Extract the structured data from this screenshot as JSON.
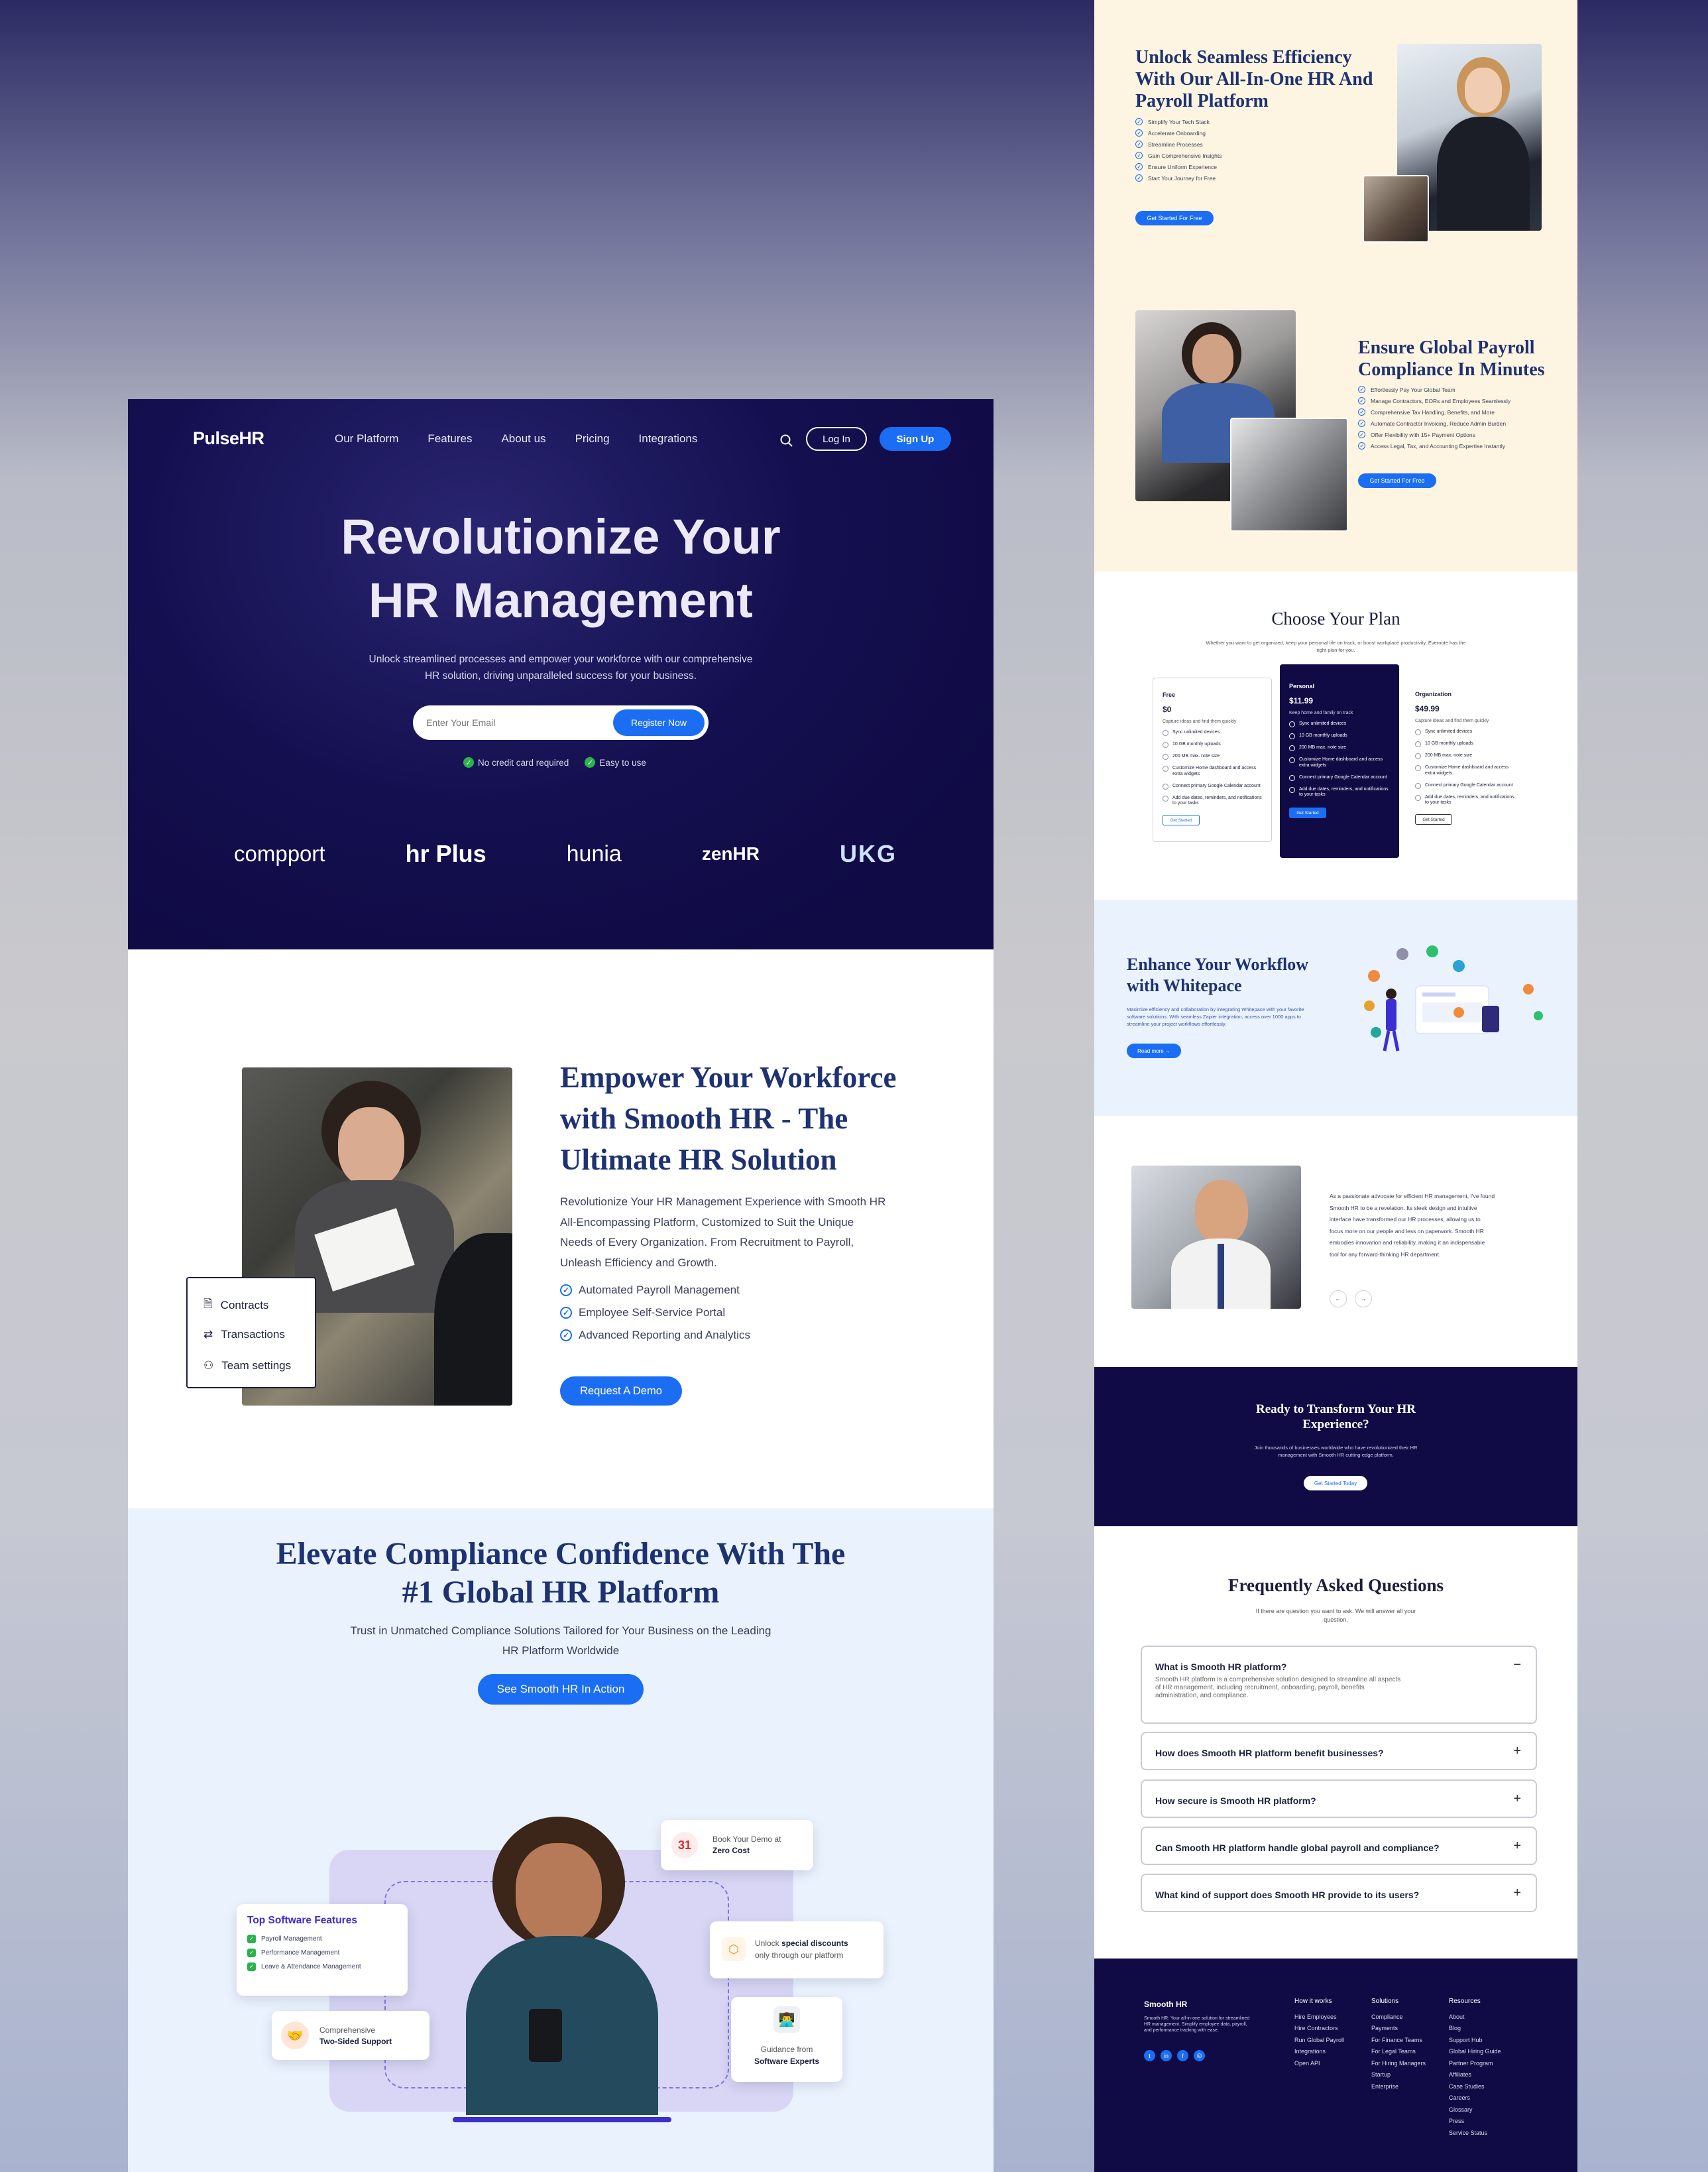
{
  "brand": "PulseHR",
  "nav": {
    "items": [
      "Our Platform",
      "Features",
      "About us",
      "Pricing",
      "Integrations"
    ],
    "login": "Log In",
    "signup": "Sign Up"
  },
  "hero": {
    "title_line1": "Revolutionize Your",
    "title_line2": "HR Management",
    "subtitle_line1": "Unlock streamlined processes and empower your workforce with our comprehensive",
    "subtitle_line2": "HR solution, driving unparalleled success for your business.",
    "email_placeholder": "Enter Your Email",
    "register": "Register Now",
    "badge1": "No credit card required",
    "badge2": "Easy to use",
    "logos": [
      "compport",
      "hr Plus",
      "hunia",
      "zenHR",
      "UKG"
    ]
  },
  "empower": {
    "title_line1": "Empower Your Workforce",
    "title_line2": "with Smooth HR - The",
    "title_line3": "Ultimate HR Solution",
    "body_line1": "Revolutionize Your HR Management Experience with Smooth HR",
    "body_line2": "All-Encompassing Platform, Customized to Suit the Unique",
    "body_line3": "Needs of Every Organization. From Recruitment to Payroll,",
    "body_line4": "Unleash Efficiency and Growth.",
    "features": [
      "Automated Payroll Management",
      "Employee Self-Service Portal",
      "Advanced Reporting and Analytics"
    ],
    "cta": "Request A Demo",
    "menu": [
      "Contracts",
      "Transactions",
      "Team settings"
    ]
  },
  "compliance": {
    "title_line1": "Elevate Compliance Confidence With The",
    "title_line2": "#1 Global HR Platform",
    "sub_line1": "Trust in Unmatched Compliance Solutions Tailored for Your Business on the Leading",
    "sub_line2": "HR Platform Worldwide",
    "cta": "See Smooth HR In Action",
    "features_title": "Top Software Features",
    "features": [
      "Payroll Management",
      "Performance Management",
      "Leave & Attendance Management"
    ],
    "demo_line1": "Book Your Demo at",
    "demo_line2": "Zero Cost",
    "discount_line1a": "Unlock ",
    "discount_line1b": "special discounts",
    "discount_line2": "only through our platform",
    "support_line1": "Comprehensive",
    "support_line2": "Two-Sided Support",
    "guidance_line1": "Guidance from",
    "guidance_line2": "Software Experts"
  },
  "seamless": {
    "title_line1": "Unlock Seamless Efficiency",
    "title_line2": "With Our All-In-One HR And",
    "title_line3": "Payroll Platform",
    "items": [
      "Simplify Your Tech Stack",
      "Accelerate Onboarding",
      "Streamline Processes",
      "Gain Comprehensive Insights",
      "Ensure Uniform Experience",
      "Start Your Journey for Free"
    ],
    "cta": "Get Started For Free"
  },
  "payroll": {
    "title_line1": "Ensure Global Payroll",
    "title_line2": "Compliance In Minutes",
    "items": [
      "Effortlessly Pay Your Global Team",
      "Manage Contractors, EORs and Employees Seamlessly",
      "Comprehensive Tax Handling, Benefits, and More",
      "Automate Contractor Invoicing, Reduce Admin Burden",
      "Offer Flexibility with 15+ Payment Options",
      "Access Legal, Tax, and Accounting Expertise Instantly"
    ],
    "cta": "Get Started For Free"
  },
  "plans": {
    "title": "Choose Your Plan",
    "sub_line1": "Whether you want to get organized, keep your personal life on track, or boost workplace productivity, Evernote has the",
    "sub_line2": "right plan for you.",
    "tiers": [
      {
        "name": "Free",
        "price": "$0",
        "desc": "Capture ideas and find them quickly",
        "features": [
          "Sync unlimited devices",
          "10 GB monthly uploads",
          "200 MB max. note size",
          "Customize Home dashboard and access extra widgets",
          "Connect primary Google Calendar account",
          "Add due dates, reminders, and notifications to your tasks"
        ],
        "cta": "Get Started"
      },
      {
        "name": "Personal",
        "price": "$11.99",
        "desc": "Keep home and family on track",
        "features": [
          "Sync unlimited devices",
          "10 GB monthly uploads",
          "200 MB max. note size",
          "Customize Home dashboard and access extra widgets",
          "Connect primary Google Calendar account",
          "Add due dates, reminders, and notifications to your tasks"
        ],
        "cta": "Get Started"
      },
      {
        "name": "Organization",
        "price": "$49.99",
        "desc": "Capture ideas and find them quickly",
        "features": [
          "Sync unlimited devices",
          "10 GB monthly uploads",
          "200 MB max. note size",
          "Customize Home dashboard and access extra widgets",
          "Connect primary Google Calendar account",
          "Add due dates, reminders, and notifications to your tasks"
        ],
        "cta": "Get Started"
      }
    ]
  },
  "workflow": {
    "title_line1": "Enhance Your Workflow",
    "title_line2": "with Whitepace",
    "body_line1": "Maximize efficiency and collaboration by integrating Whitepace with your favorite",
    "body_line2": "software solutions. With seamless Zapier integration, access over 1000 apps to",
    "body_line3": "streamline your project workflows effortlessly.",
    "cta": "Read more"
  },
  "testimonial": {
    "lines": [
      "As a passionate advocate for efficient HR management, I've found",
      "Smooth HR to be a revelation. Its sleek design and intuitive",
      "interface have transformed our HR processes, allowing us to",
      "focus more on our people and less on paperwork. Smooth HR",
      "embodies innovation and reliability, making it an indispensable",
      "tool for any forward-thinking HR department."
    ],
    "prev": "←",
    "next": "→"
  },
  "cta_band": {
    "title_line1": "Ready to Transform Your HR",
    "title_line2": "Experience?",
    "sub_line1": "Join thousands of businesses worldwide who have revolutionized their HR",
    "sub_line2": "management with Smooth HR cutting-edge platform.",
    "cta": "Get Started Today"
  },
  "faq": {
    "title": "Frequently Asked Questions",
    "sub_line1": "If there are question you want to ask. We will answer all your",
    "sub_line2": "question.",
    "open_q": "What is Smooth HR platform?",
    "open_a_line1": "Smooth HR platform is a comprehensive solution designed to streamline all aspects",
    "open_a_line2": "of HR management, including recruitment, onboarding, payroll, benefits",
    "open_a_line3": "administration, and compliance.",
    "questions": [
      "How does Smooth HR platform benefit businesses?",
      "How secure is Smooth HR platform?",
      "Can Smooth HR platform handle global payroll and compliance?",
      "What kind of support does Smooth HR provide to its users?"
    ]
  },
  "footer": {
    "brand": "Smooth HR",
    "blurb_line1": "Smooth HR: Your all-in-one solution for streamlined",
    "blurb_line2": "HR management. Simplify employee data, payroll,",
    "blurb_line3": "and performance tracking with ease.",
    "col1": {
      "title": "How it works",
      "items": [
        "Hire Employees",
        "Hire Contractors",
        "Run Global Payroll",
        "Integrations",
        "Open API"
      ]
    },
    "col2": {
      "title": "Solutions",
      "items": [
        "Compliance",
        "Payments",
        "For Finance Teams",
        "For Legal Teams",
        "For Hiring Managers",
        "Startup",
        "Enterprise"
      ]
    },
    "col3": {
      "title": "Resources",
      "items": [
        "About",
        "Blog",
        "Support Hub",
        "Global Hiring Guide",
        "Partner Program",
        "Affiliates",
        "Case Studies",
        "Careers",
        "Glossary",
        "Press",
        "Service Status"
      ]
    }
  },
  "colors": {
    "navy": "#100b45",
    "blue": "#1b6ef3",
    "cream": "#fdf5e1",
    "lightblue": "#eaf3fd"
  }
}
